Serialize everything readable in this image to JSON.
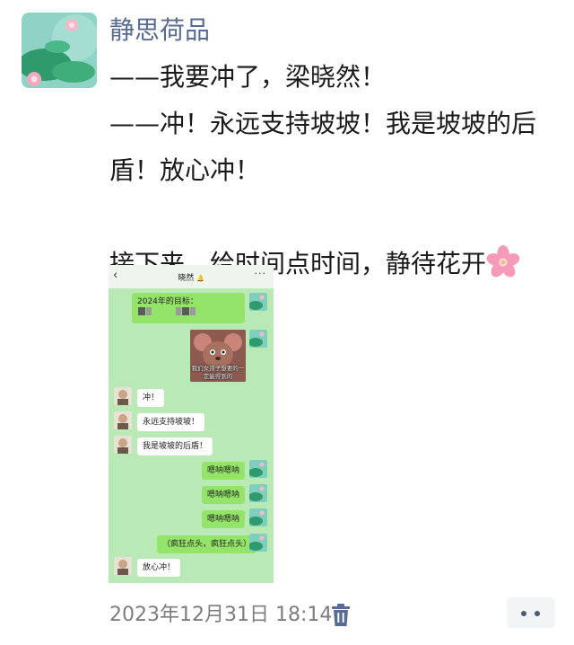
{
  "post": {
    "author": "静思荷品",
    "text": "——我要冲了，梁晓然！\n——冲！永远支持坡坡！我是坡坡的后盾！放心冲！\n\n接下来，给时间点时间，静待花开",
    "timestamp": "2023年12月31日 18:14"
  },
  "screenshot": {
    "header": {
      "back": "‹",
      "title": "晓然",
      "more": "···"
    },
    "sticker_caption": "我们女孩子想要的一定能得到的",
    "messages": [
      {
        "side": "me",
        "text": "2024年的目标："
      },
      {
        "side": "them",
        "text": "冲！"
      },
      {
        "side": "them",
        "text": "永远支持坡坡！"
      },
      {
        "side": "them",
        "text": "我是坡坡的后盾！"
      },
      {
        "side": "me",
        "text": "嗯呐嗯呐"
      },
      {
        "side": "me",
        "text": "嗯呐嗯呐"
      },
      {
        "side": "me",
        "text": "嗯呐嗯呐"
      },
      {
        "side": "me",
        "text": "（疯狂点头，疯狂点头）"
      },
      {
        "side": "them",
        "text": "放心冲！"
      }
    ]
  },
  "icons": {
    "trash": "trash-icon",
    "more": "more-dots-icon",
    "flower": "cherry-blossom-emoji",
    "back": "chevron-left-icon",
    "mute": "mute-bell-icon"
  },
  "colors": {
    "author": "#576b95",
    "chat_background": "#b9eab5",
    "my_bubble": "#94e46a",
    "their_bubble": "#ffffff",
    "timestamp": "#7d7d7d"
  }
}
